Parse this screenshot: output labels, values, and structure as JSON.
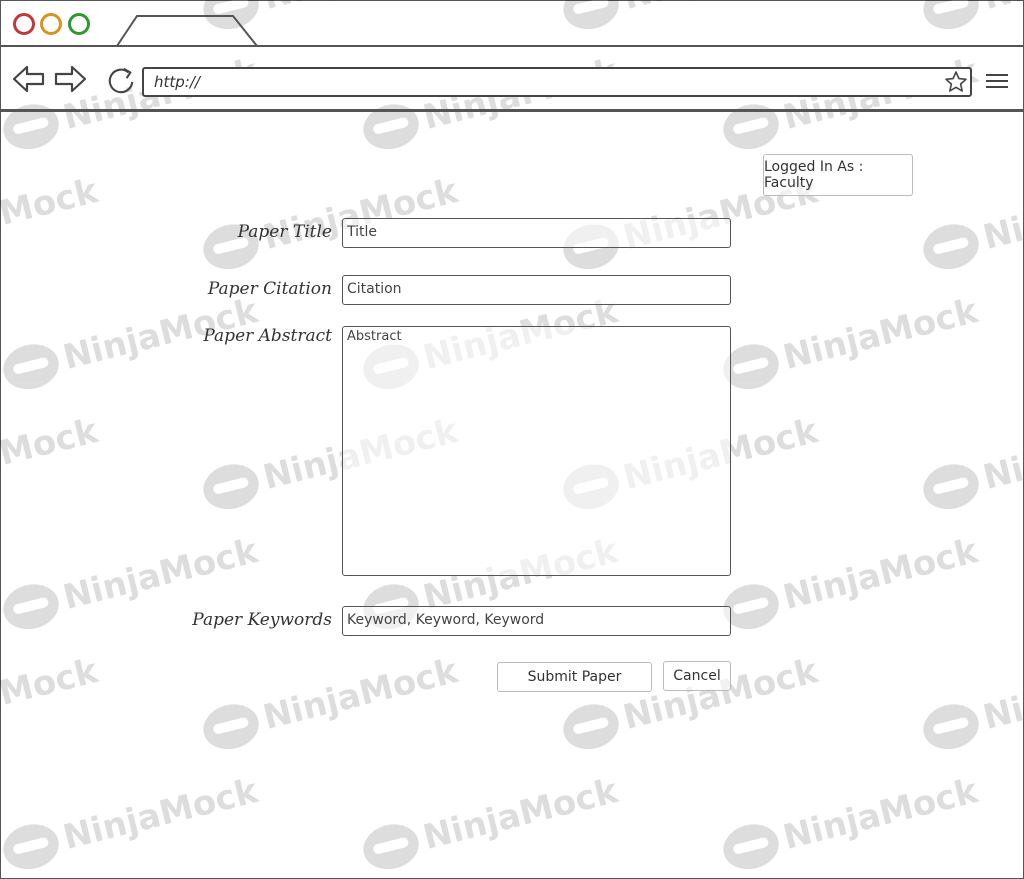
{
  "browser": {
    "url": "http://",
    "watermark_text": "NinjaMock"
  },
  "header": {
    "login_status": "Logged In As : Faculty"
  },
  "form": {
    "title_label": "Paper Title",
    "title_placeholder": "Title",
    "citation_label": "Paper Citation",
    "citation_placeholder": "Citation",
    "abstract_label": "Paper Abstract",
    "abstract_placeholder": "Abstract",
    "keywords_label": "Paper Keywords",
    "keywords_placeholder": "Keyword, Keyword, Keyword",
    "submit_label": "Submit Paper",
    "cancel_label": "Cancel"
  },
  "icons": {
    "back": "back-arrow-icon",
    "forward": "forward-arrow-icon",
    "reload": "reload-icon",
    "bookmark": "star-icon",
    "menu": "hamburger-menu-icon"
  },
  "colors": {
    "close_dot": "#c0393b",
    "minimize_dot": "#d9931e",
    "maximize_dot": "#2e9a2e"
  }
}
